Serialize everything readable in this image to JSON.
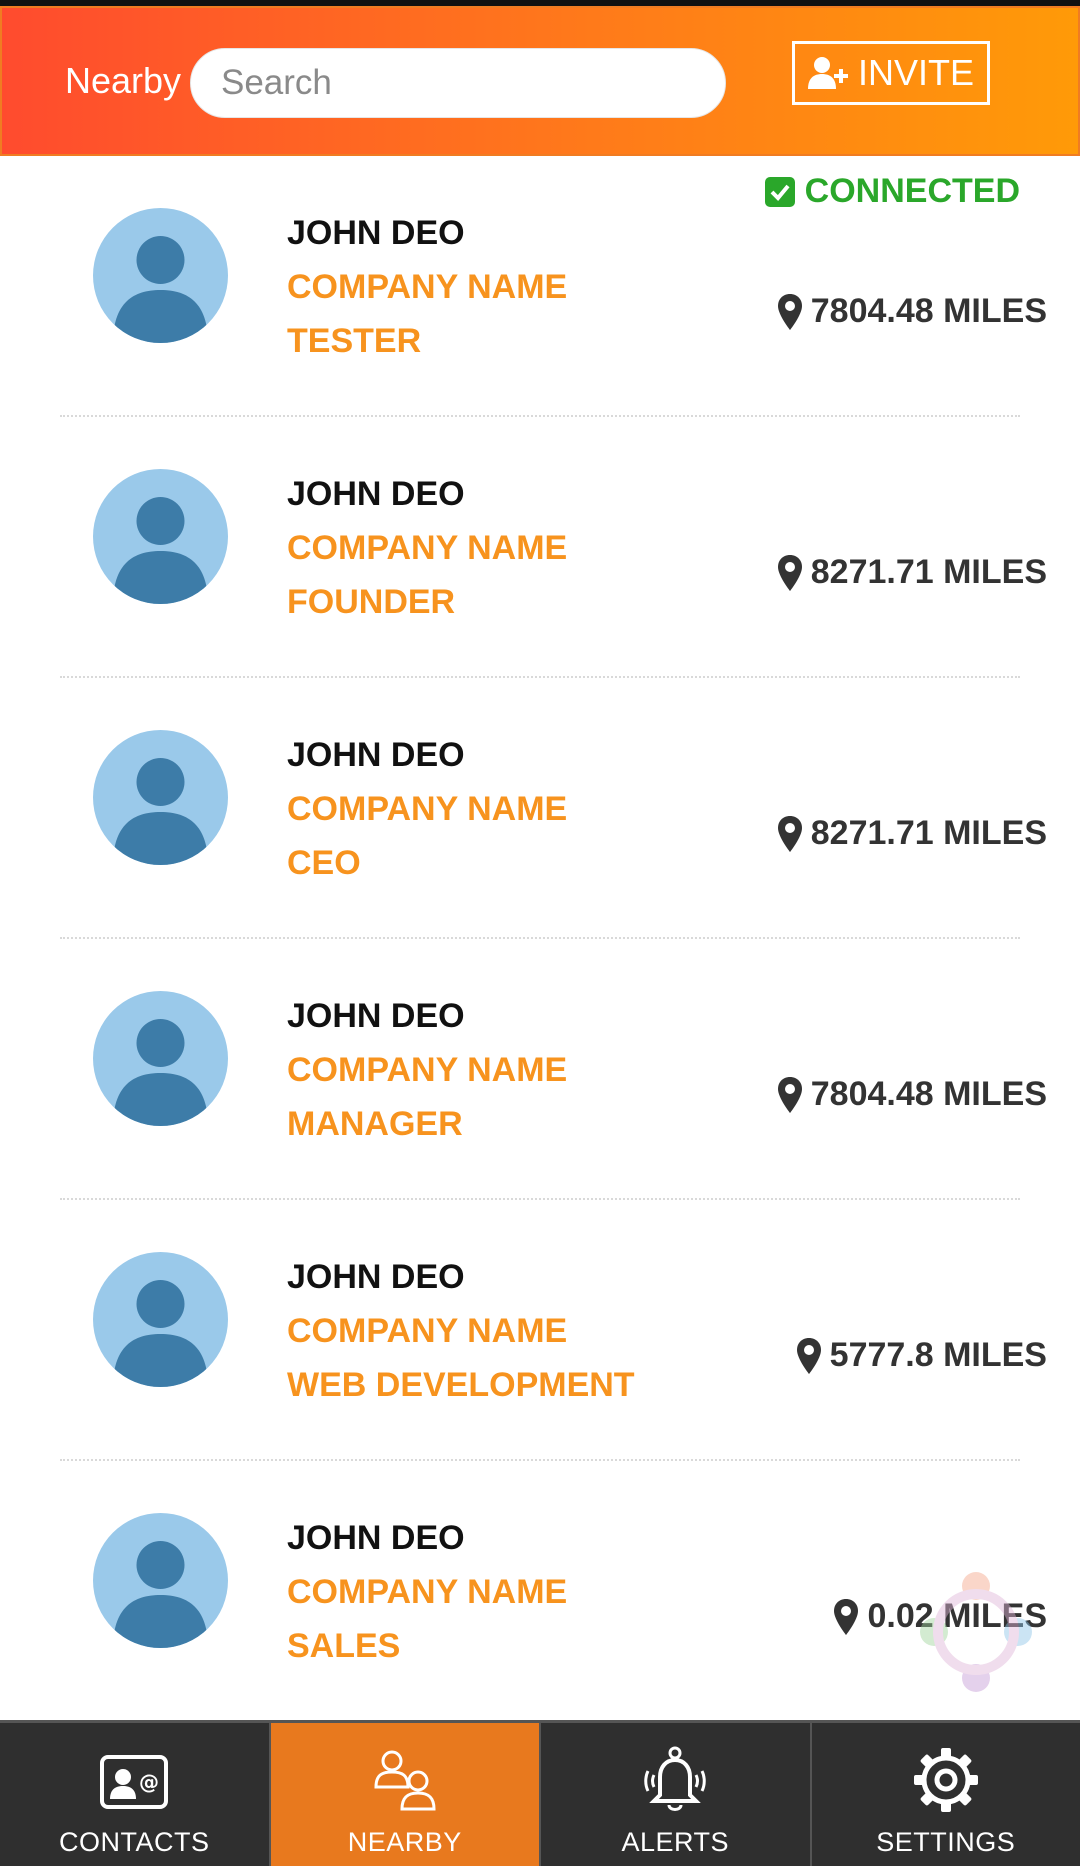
{
  "header": {
    "title": "Nearby",
    "search_placeholder": "Search",
    "invite_label": "INVITE"
  },
  "accent_color": "#f7931e",
  "connected_color": "#2aa72a",
  "people": [
    {
      "name": "JOHN DEO",
      "company": "COMPANY NAME",
      "role": "TESTER",
      "distance": "7804.48 MILES",
      "status": "CONNECTED"
    },
    {
      "name": "JOHN DEO",
      "company": "COMPANY NAME",
      "role": "FOUNDER",
      "distance": "8271.71 MILES"
    },
    {
      "name": "JOHN DEO",
      "company": "COMPANY NAME",
      "role": "CEO",
      "distance": "8271.71 MILES"
    },
    {
      "name": "JOHN DEO",
      "company": "COMPANY NAME",
      "role": "MANAGER",
      "distance": "7804.48 MILES"
    },
    {
      "name": "JOHN DEO",
      "company": "COMPANY NAME",
      "role": "WEB DEVELOPMENT",
      "distance": "5777.8 MILES"
    },
    {
      "name": "JOHN DEO",
      "company": "COMPANY NAME",
      "role": "SALES",
      "distance": "0.02 MILES"
    }
  ],
  "tabs": [
    {
      "label": "CONTACTS",
      "icon": "contact-card-icon"
    },
    {
      "label": "NEARBY",
      "icon": "nearby-people-icon",
      "active": true
    },
    {
      "label": "ALERTS",
      "icon": "bell-icon"
    },
    {
      "label": "SETTINGS",
      "icon": "gear-icon"
    }
  ]
}
